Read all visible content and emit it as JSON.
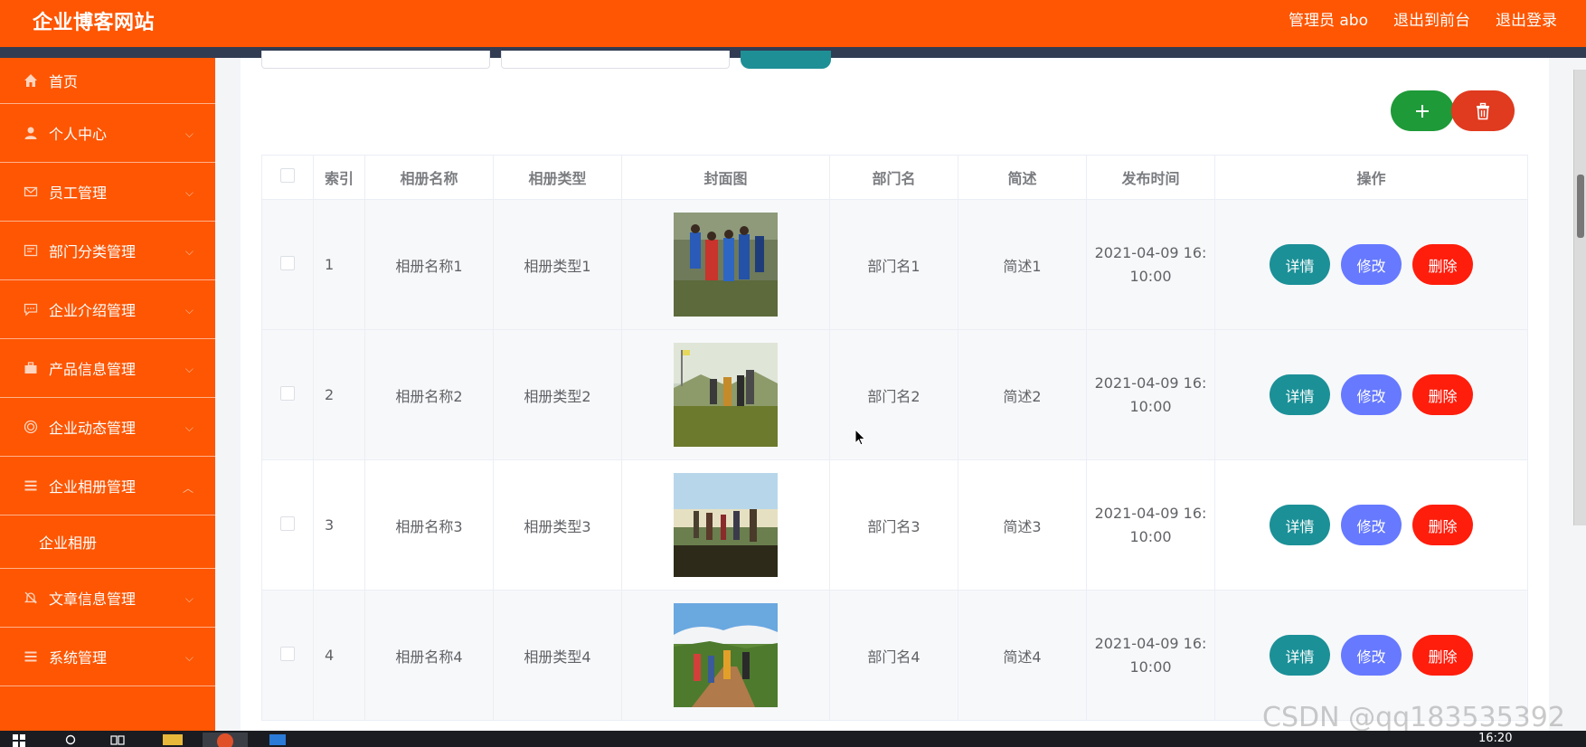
{
  "header": {
    "site_title": "企业博客网站",
    "admin_label": "管理员 abo",
    "to_front_label": "退出到前台",
    "logout_label": "退出登录"
  },
  "sidebar": {
    "items": [
      {
        "label": "首页",
        "icon": "home-icon"
      },
      {
        "label": "个人中心",
        "icon": "user-icon"
      },
      {
        "label": "员工管理",
        "icon": "mail-icon"
      },
      {
        "label": "部门分类管理",
        "icon": "message-icon"
      },
      {
        "label": "企业介绍管理",
        "icon": "chat-icon"
      },
      {
        "label": "产品信息管理",
        "icon": "briefcase-icon"
      },
      {
        "label": "企业动态管理",
        "icon": "target-icon"
      },
      {
        "label": "企业相册管理",
        "icon": "list-icon",
        "expanded": true
      },
      {
        "label": "企业相册",
        "sub": true
      },
      {
        "label": "文章信息管理",
        "icon": "bell-off-icon"
      },
      {
        "label": "系统管理",
        "icon": "list-icon"
      }
    ]
  },
  "toolbar": {
    "add_icon": "plus-icon",
    "delete_icon": "trash-icon"
  },
  "table": {
    "columns": [
      "索引",
      "相册名称",
      "相册类型",
      "封面图",
      "部门名",
      "简述",
      "发布时间",
      "操作"
    ],
    "rows": [
      {
        "index": "1",
        "name": "相册名称1",
        "type": "相册类型1",
        "dept": "部门名1",
        "desc": "简述1",
        "time_line1": "2021-04-09 16:",
        "time_line2": "10:00"
      },
      {
        "index": "2",
        "name": "相册名称2",
        "type": "相册类型2",
        "dept": "部门名2",
        "desc": "简述2",
        "time_line1": "2021-04-09 16:",
        "time_line2": "10:00"
      },
      {
        "index": "3",
        "name": "相册名称3",
        "type": "相册类型3",
        "dept": "部门名3",
        "desc": "简述3",
        "time_line1": "2021-04-09 16:",
        "time_line2": "10:00"
      },
      {
        "index": "4",
        "name": "相册名称4",
        "type": "相册类型4",
        "dept": "部门名4",
        "desc": "简述4",
        "time_line1": "2021-04-09 16:",
        "time_line2": "10:00"
      }
    ],
    "row_actions": {
      "detail": "详情",
      "edit": "修改",
      "delete": "删除"
    }
  },
  "taskbar": {
    "clock": "16:20"
  },
  "watermark": "CSDN @qq183535392",
  "colors": {
    "primary": "#fe5602",
    "dark_strip": "#313c53",
    "detail": "#1b9097",
    "edit": "#6679ff",
    "delete": "#ff1d0c",
    "add": "#1e9a38"
  }
}
